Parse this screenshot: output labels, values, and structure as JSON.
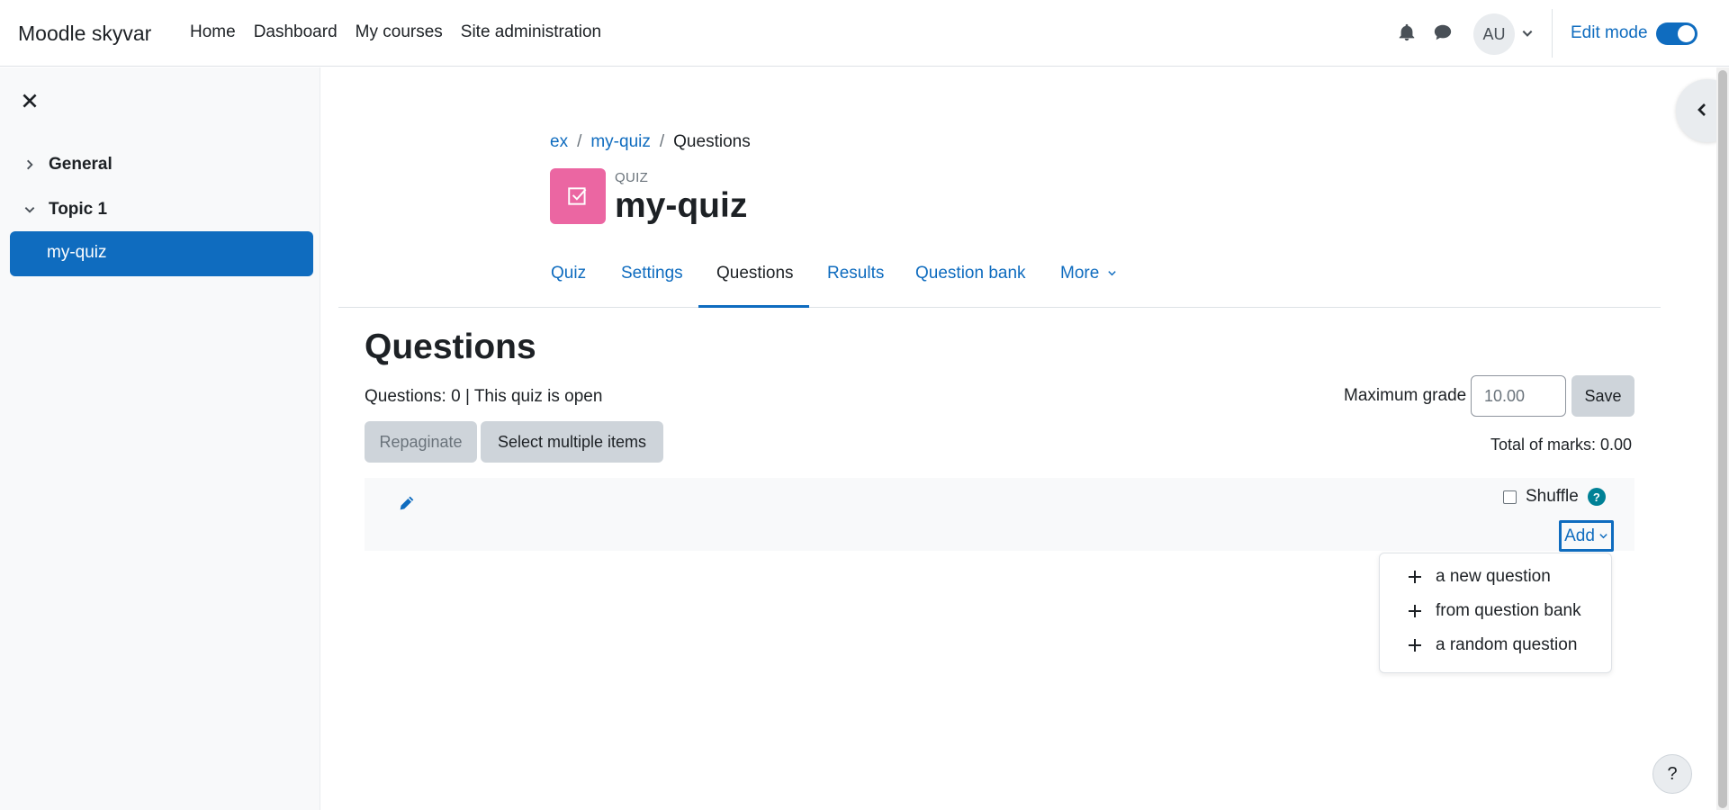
{
  "navbar": {
    "brand": "Moodle skyvar",
    "links": [
      "Home",
      "Dashboard",
      "My courses",
      "Site administration"
    ],
    "avatar_initials": "AU",
    "edit_mode_label": "Edit mode",
    "edit_mode_on": true,
    "icons": [
      "bell-icon",
      "chat-icon",
      "chevron-down-icon"
    ]
  },
  "drawer": {
    "items": [
      {
        "label": "General",
        "expanded": false
      },
      {
        "label": "Topic 1",
        "expanded": true
      }
    ],
    "active_item": "my-quiz"
  },
  "breadcrumb": [
    "ex",
    "my-quiz",
    "Questions"
  ],
  "activity": {
    "type_label": "QUIZ",
    "title": "my-quiz",
    "icon_color": "#eb66a2"
  },
  "tabs": [
    "Quiz",
    "Settings",
    "Questions",
    "Results",
    "Question bank",
    "More"
  ],
  "active_tab": "Questions",
  "main": {
    "heading": "Questions",
    "status": "Questions: 0 | This quiz is open",
    "repaginate_label": "Repaginate",
    "select_multiple_label": "Select multiple items",
    "max_grade_label": "Maximum grade",
    "max_grade_value": "10.00",
    "save_label": "Save",
    "total_marks": "Total of marks: 0.00",
    "shuffle_label": "Shuffle",
    "shuffle_checked": false,
    "add_label": "Add"
  },
  "add_menu": [
    "a new question",
    "from question bank",
    "a random question"
  ],
  "help_fab": "?",
  "colors": {
    "primary": "#0f6cbf",
    "quiz_icon": "#eb66a2",
    "help_icon": "#008196"
  }
}
